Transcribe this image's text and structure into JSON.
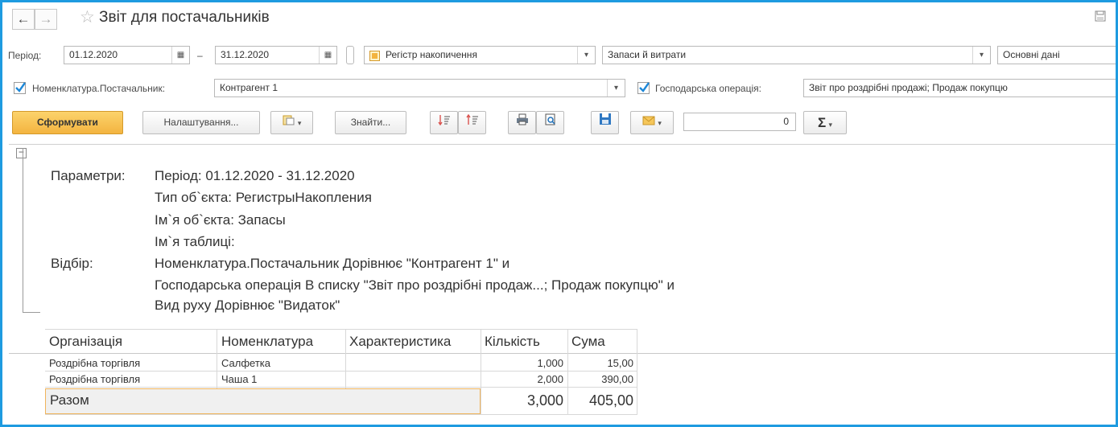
{
  "window": {
    "title": "Звіт для постачальників"
  },
  "form": {
    "period_label": "Період:",
    "date_from": "01.12.2020",
    "date_sep": "–",
    "date_to": "31.12.2020",
    "object_type": "Регістр накопичення",
    "object_name": "Запаси й витрати",
    "table_name": "Основні дані",
    "supplier_filter_label": "Номенклатура.Постачальник:",
    "supplier_filter_value": "Контрагент 1",
    "operation_filter_label": "Господарська операція:",
    "operation_filter_value": "Звіт про роздрібні продажі; Продаж покупцю"
  },
  "toolbar": {
    "generate_label": "Сформувати",
    "settings_label": "Налаштування...",
    "find_label": "Знайти...",
    "sum_value": "0"
  },
  "report": {
    "params_label": "Параметри:",
    "params": [
      "Період: 01.12.2020 - 31.12.2020",
      "Тип об`єкта: РегистрыНакопления",
      "Ім`я об`єкта: Запасы",
      "Ім`я таблиці:"
    ],
    "filter_label": "Відбір:",
    "filters": [
      "Номенклатура.Постачальник Дорівнює \"Контрагент 1\" и",
      "Господарська операція В списку \"Звіт про роздрібні продаж...; Продаж покупцю\" и",
      "Вид руху Дорівнює \"Видаток\""
    ],
    "columns": [
      "Організація",
      "Номенклатура",
      "Характеристика",
      "Кількість",
      "Сума"
    ],
    "rows": [
      {
        "org": "Роздрібна торгівля",
        "item": "Салфетка",
        "char": "",
        "qty": "1,000",
        "sum": "15,00"
      },
      {
        "org": "Роздрібна торгівля",
        "item": "Чаша 1",
        "char": "",
        "qty": "2,000",
        "sum": "390,00"
      }
    ],
    "total_label": "Разом",
    "total_qty": "3,000",
    "total_sum": "405,00"
  },
  "icons": {
    "back": "arrow-left-icon",
    "forward": "arrow-right-icon",
    "favorite": "star-icon",
    "save": "floppy-disk-icon",
    "calendar": "calendar-icon",
    "register": "register-icon",
    "dropdown": "chevron-down-icon",
    "print": "printer-icon",
    "preview": "print-preview-icon",
    "mail": "envelope-icon",
    "sum": "sigma-icon"
  },
  "colors": {
    "accent_border": "#1e9be0",
    "primary_button": "#f3b440",
    "checkbox": "#1e88d8",
    "total_border": "#f0b45c"
  }
}
